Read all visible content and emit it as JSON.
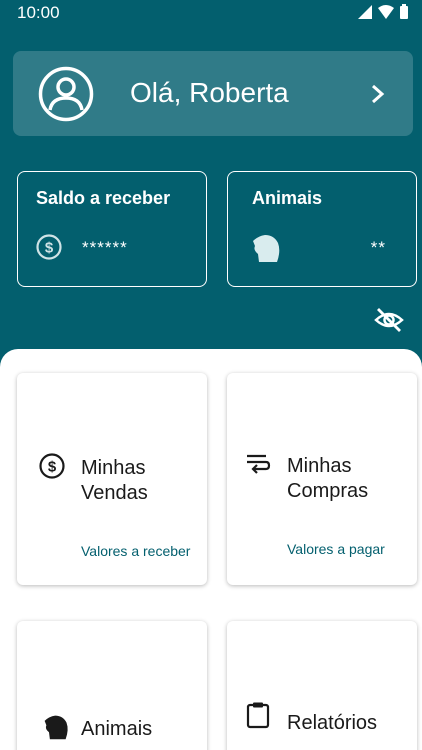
{
  "status_bar": {
    "time": "10:00"
  },
  "greeting": {
    "text": "Olá, Roberta"
  },
  "cards": {
    "saldo": {
      "title": "Saldo a receber",
      "value": "******"
    },
    "animais": {
      "title": "Animais",
      "value": "**"
    }
  },
  "menu": {
    "vendas": {
      "line1": "Minhas",
      "line2": "Vendas",
      "sub": "Valores a receber"
    },
    "compras": {
      "line1": "Minhas",
      "line2": "Compras",
      "sub": "Valores a pagar"
    },
    "animais": {
      "label": "Animais"
    },
    "relatorios": {
      "label": "Relatórios"
    }
  },
  "colors": {
    "primary": "#035f6e",
    "white": "#ffffff",
    "text_dark": "#1a1a1a"
  },
  "icons": [
    "signal-icon",
    "wifi-icon",
    "battery-icon",
    "avatar-icon",
    "chevron-right-icon",
    "dollar-icon",
    "horse-icon",
    "eye-off-icon",
    "transfer-icon",
    "clipboard-icon"
  ]
}
